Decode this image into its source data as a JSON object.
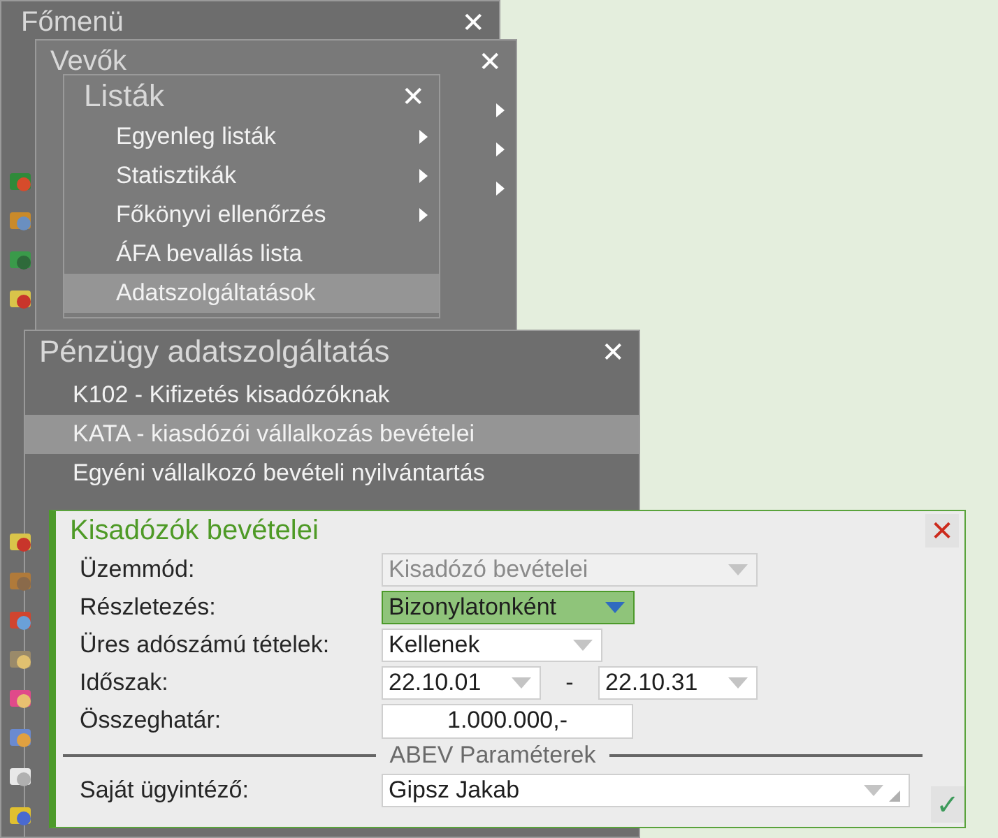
{
  "windows": [
    {
      "kind": "main",
      "title": "Főmenü",
      "close": "✕"
    },
    {
      "kind": "sub",
      "title": "Vevők",
      "close": "✕",
      "items": [
        {
          "has_submenu": true
        },
        {
          "has_submenu": true
        },
        {
          "has_submenu": true
        }
      ]
    },
    {
      "kind": "list",
      "title": "Listák",
      "close": "✕",
      "items": [
        {
          "label": "Egyenleg listák",
          "has_submenu": true,
          "selected": false
        },
        {
          "label": "Statisztikák",
          "has_submenu": true,
          "selected": false
        },
        {
          "label": "Főkönyvi ellenőrzés",
          "has_submenu": true,
          "selected": false
        },
        {
          "label": "ÁFA bevallás lista",
          "has_submenu": false,
          "selected": false
        },
        {
          "label": "Adatszolgáltatások",
          "has_submenu": false,
          "selected": true
        }
      ]
    },
    {
      "kind": "wide",
      "title": "Pénzügy adatszolgáltatás",
      "close": "✕",
      "items": [
        {
          "label": "K102 - Kifizetés kisadózóknak",
          "has_submenu": false,
          "selected": false
        },
        {
          "label": "KATA - kiasdózói vállalkozás bevételei",
          "has_submenu": false,
          "selected": true
        },
        {
          "label": "Egyéni vállalkozó bevételi nyilvántartás",
          "has_submenu": false,
          "selected": false
        }
      ]
    }
  ],
  "dialog": {
    "title": "Kisadózók bevételei",
    "close": "✕",
    "fields": [
      {
        "kind": "select",
        "label": "Üzemmód:",
        "value": "Kisadózó bevételei",
        "disabled": true,
        "highlighted": false
      },
      {
        "kind": "select",
        "label": "Részletezés:",
        "value": "Bizonylatonként",
        "disabled": false,
        "highlighted": true
      },
      {
        "kind": "select",
        "label": "Üres adószámú tételek:",
        "value": "Kellenek",
        "disabled": false,
        "highlighted": false
      },
      {
        "kind": "range",
        "label": "Időszak:",
        "from": "22.10.01",
        "separator": "-",
        "to": "22.10.31"
      },
      {
        "kind": "input",
        "label": "Összeghatár:",
        "value": "1.000.000,-"
      }
    ],
    "section": {
      "title": "ABEV Paraméterek",
      "fields": [
        {
          "kind": "combo",
          "label": "Saját ügyintéző:",
          "value": "Gipsz Jakab",
          "disabled": false,
          "highlighted": false
        }
      ]
    },
    "confirm": "✓"
  }
}
